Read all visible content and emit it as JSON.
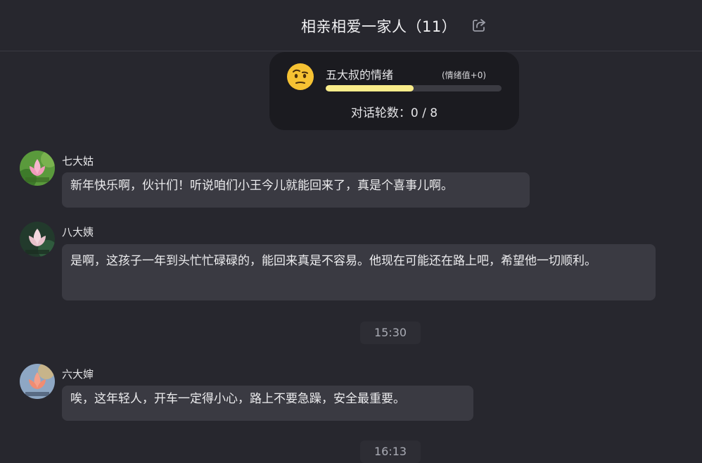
{
  "header": {
    "title": "相亲相爱一家人（11）",
    "share_icon": "share-icon"
  },
  "emotion": {
    "face_icon": "raised-eyebrow-face-icon",
    "name": "五大叔的情绪",
    "value_text": "(情绪值+0)",
    "progress_fraction": 0.5,
    "bar_color": "#f9ec8a",
    "rounds_text": "对话轮数：0 / 8"
  },
  "messages": [
    {
      "sender": "七大姑",
      "text": "新年快乐啊，伙计们！听说咱们小王今儿就能回来了，真是个喜事儿啊。"
    },
    {
      "sender": "八大姨",
      "text": "是啊，这孩子一年到头忙忙碌碌的，能回来真是不容易。他现在可能还在路上吧，希望他一切顺利。"
    },
    {
      "sender": "六大婶",
      "text": "唉，这年轻人，开车一定得小心，路上不要急躁，安全最重要。"
    }
  ],
  "timestamps": [
    "15:30",
    "16:13"
  ]
}
